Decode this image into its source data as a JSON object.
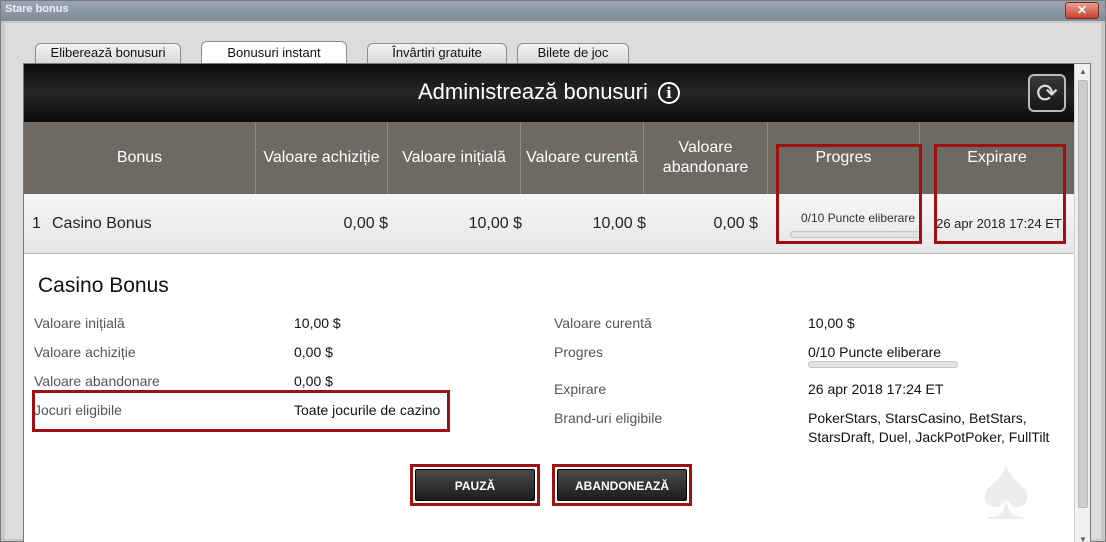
{
  "window": {
    "title": "Stare bonus",
    "close_label": "✕"
  },
  "tabs": [
    {
      "label": "Eliberează bonusuri"
    },
    {
      "label": "Bonusuri instant"
    },
    {
      "label": "Învârtiri gratuite"
    },
    {
      "label": "Bilete de joc"
    }
  ],
  "admin": {
    "title": "Administrează bonusuri",
    "info_glyph": "i",
    "refresh_glyph": "⟳"
  },
  "columns": {
    "bonus": "Bonus",
    "acquisition": "Valoare achiziție",
    "initial": "Valoare inițială",
    "current": "Valoare curentă",
    "abandon": "Valoare abandonare",
    "progress": "Progres",
    "expiry": "Expirare"
  },
  "row": {
    "index": "1",
    "name": "Casino Bonus",
    "acquisition": "0,00 $",
    "initial": "10,00 $",
    "current": "10,00 $",
    "abandon": "0,00 $",
    "progress_text": "0/10 Puncte eliberare",
    "progress_fraction": 0,
    "expiry": "26 apr 2018 17:24 ET"
  },
  "detail": {
    "title": "Casino Bonus",
    "left": [
      {
        "label": "Valoare inițială",
        "value": "10,00 $"
      },
      {
        "label": "Valoare achiziție",
        "value": "0,00 $"
      },
      {
        "label": "Valoare abandonare",
        "value": "0,00 $"
      },
      {
        "label": "Jocuri eligibile",
        "value": "Toate jocurile de cazino"
      }
    ],
    "right": {
      "current_label": "Valoare curentă",
      "current_value": "10,00 $",
      "progress_label": "Progres",
      "progress_value": "0/10 Puncte eliberare",
      "expiry_label": "Expirare",
      "expiry_value": "26 apr 2018 17:24 ET",
      "brands_label": "Brand-uri eligibile",
      "brands_line1": "PokerStars, StarsCasino, BetStars,",
      "brands_line2": "StarsDraft, Duel, JackPotPoker, FullTilt"
    }
  },
  "buttons": {
    "pause": "PAUZĂ",
    "abandon": "ABANDONEAZĂ"
  },
  "icons": {
    "watermark": "spade-star-watermark-icon"
  },
  "colors": {
    "highlight_red": "#a01010",
    "header_gray": "#6d6a63",
    "progress_green": "#39a03a"
  }
}
